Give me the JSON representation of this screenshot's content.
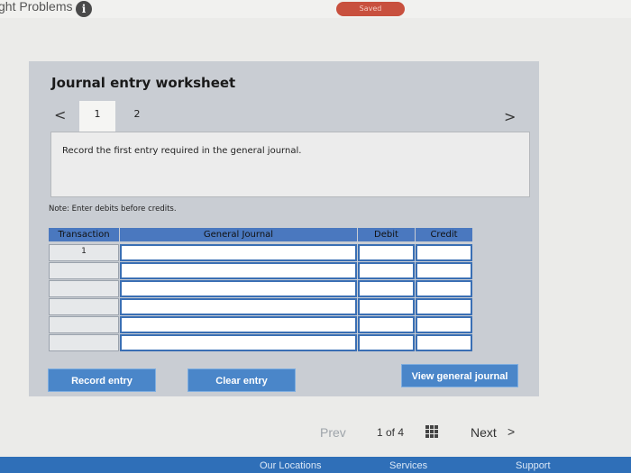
{
  "header": {
    "title": "ght Problems",
    "info_icon": "i",
    "saved_label": "Saved"
  },
  "worksheet": {
    "title": "Journal entry worksheet",
    "steps": [
      "1",
      "2"
    ],
    "active_step": "1",
    "prev_icon": "<",
    "next_icon": ">",
    "instruction": "Record the first entry required in the general journal.",
    "note": "Note: Enter debits before credits.",
    "table": {
      "columns": [
        "Transaction",
        "General Journal",
        "Debit",
        "Credit"
      ],
      "rows": [
        {
          "transaction": "1",
          "general_journal": "",
          "debit": "",
          "credit": ""
        },
        {
          "transaction": "",
          "general_journal": "",
          "debit": "",
          "credit": ""
        },
        {
          "transaction": "",
          "general_journal": "",
          "debit": "",
          "credit": ""
        },
        {
          "transaction": "",
          "general_journal": "",
          "debit": "",
          "credit": ""
        },
        {
          "transaction": "",
          "general_journal": "",
          "debit": "",
          "credit": ""
        },
        {
          "transaction": "",
          "general_journal": "",
          "debit": "",
          "credit": ""
        }
      ]
    },
    "buttons": {
      "record": "Record entry",
      "clear": "Clear entry",
      "view": "View general journal"
    }
  },
  "pager": {
    "prev": "Prev",
    "count": "1 of 4",
    "next": "Next",
    "next_icon": ">"
  },
  "footer": {
    "links": [
      "Our Locations",
      "Services",
      "Support"
    ]
  },
  "colors": {
    "accent": "#4a86c9",
    "table_border": "#3a6fb4",
    "saved_badge": "#c8503e",
    "footer": "#2f6fb8"
  }
}
